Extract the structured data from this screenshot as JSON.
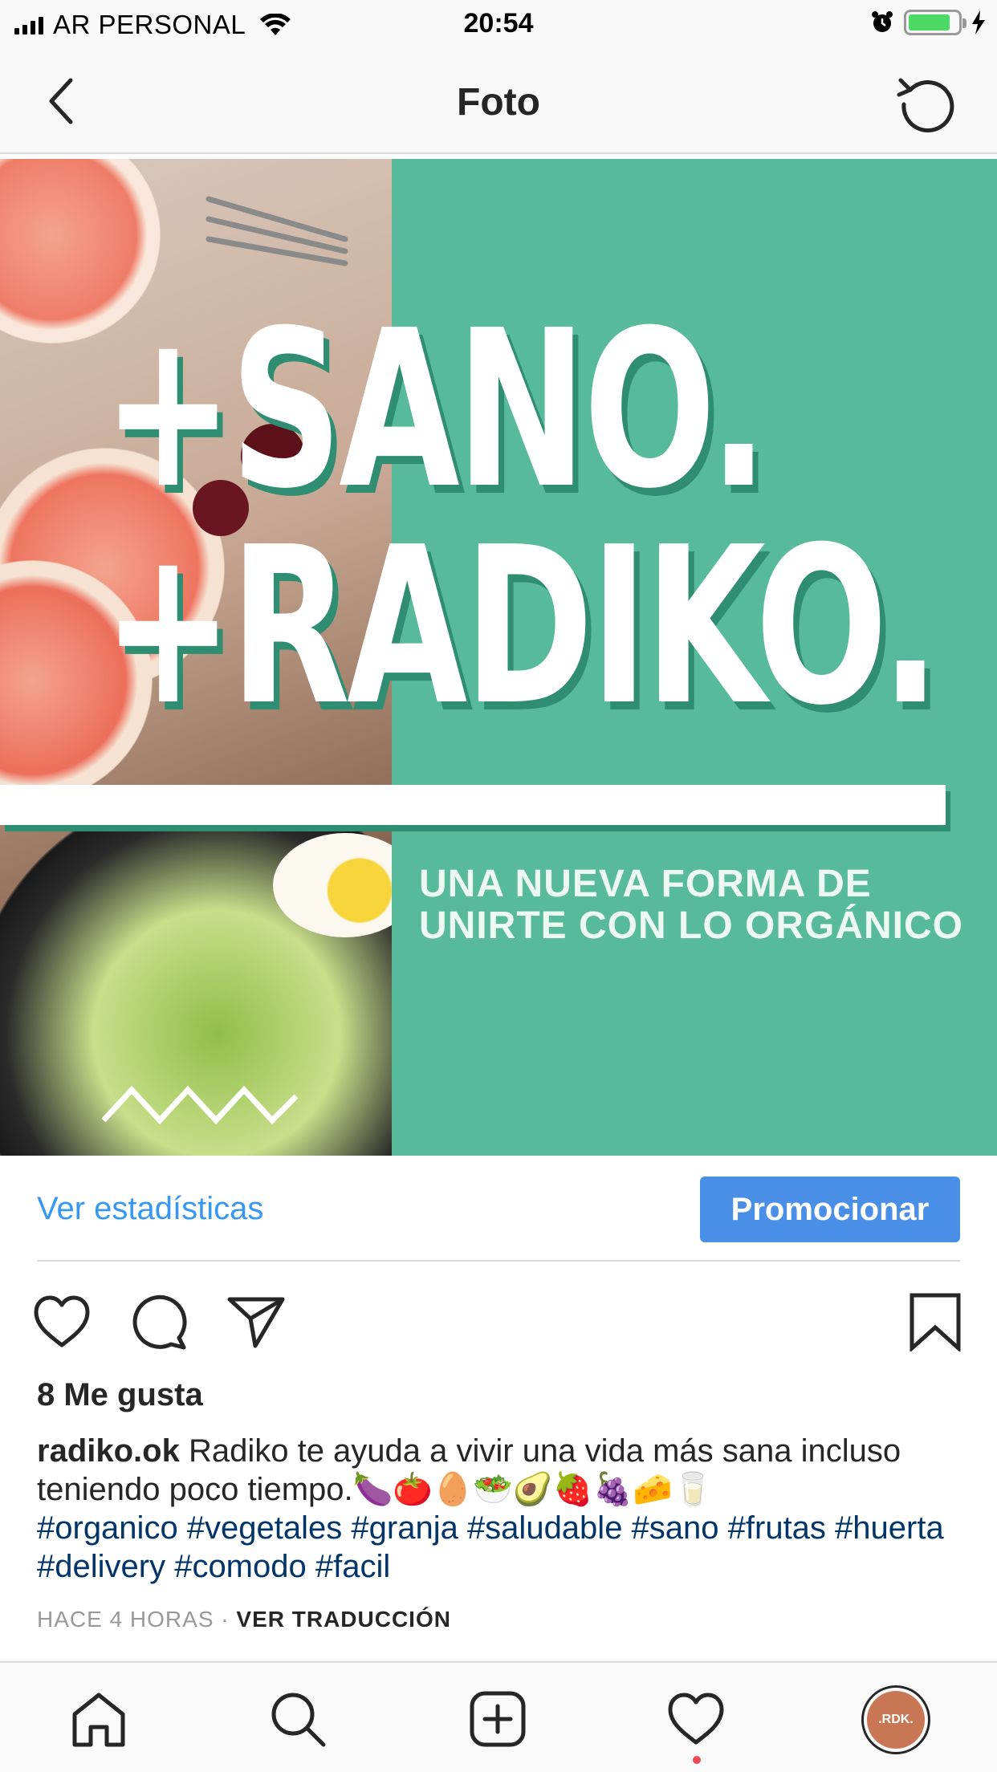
{
  "status_bar": {
    "carrier": "AR PERSONAL",
    "time": "20:54",
    "signal_icon": "signal-bars-icon",
    "wifi_icon": "wifi-icon",
    "alarm_icon": "alarm-clock-icon",
    "battery_icon": "battery-icon",
    "charging_icon": "charging-bolt-icon",
    "battery_level": 0.85
  },
  "nav": {
    "title": "Foto",
    "back_icon": "chevron-left-icon",
    "refresh_icon": "refresh-icon"
  },
  "post_image": {
    "headline_line1": "+SANO.",
    "headline_line2": "+RADIKO.",
    "tagline_line1": "UNA NUEVA FORMA DE",
    "tagline_line2": "UNIRTE CON LO ORGÁNICO",
    "colors": {
      "green": "#57bb9b",
      "shadow": "#2f8e72"
    }
  },
  "actions": {
    "stats_link": "Ver estadísticas",
    "promote_button": "Promocionar"
  },
  "icons_row": {
    "like": "heart-icon",
    "comment": "comment-icon",
    "share": "paper-plane-icon",
    "save": "bookmark-icon"
  },
  "post": {
    "likes": "8 Me gusta",
    "username": "radiko.ok",
    "caption_text": " Radiko te ayuda a vivir una vida más sana incluso teniendo poco tiempo.🍆🍅🥚🥗🥑🍓🍇🧀🥛",
    "hashtags": "#organico #vegetales #granja #saludable #sano #frutas #huerta #delivery #comodo #facil",
    "time_ago": "HACE 4 HORAS",
    "separator": " · ",
    "translate": "VER TRADUCCIÓN"
  },
  "tab_bar": {
    "home": "home-icon",
    "search": "search-icon",
    "add": "add-post-icon",
    "activity": "heart-icon",
    "profile": "profile-avatar",
    "avatar_text": ".RDK."
  }
}
